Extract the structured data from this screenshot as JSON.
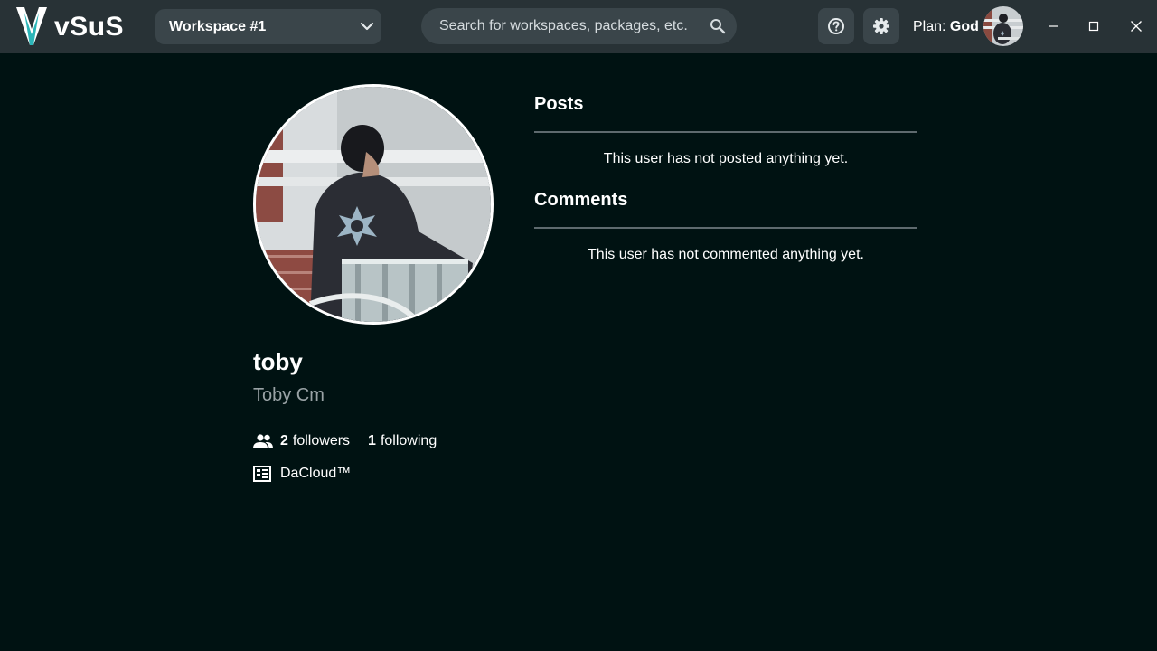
{
  "app": {
    "name": "vSuS"
  },
  "header": {
    "workspace_label": "Workspace #1",
    "search_placeholder": "Search for workspaces, packages, etc.",
    "plan_label": "Plan:",
    "plan_value": "God"
  },
  "profile": {
    "username": "toby",
    "full_name": "Toby Cm",
    "followers_count": "2",
    "followers_label": "followers",
    "following_count": "1",
    "following_label": "following",
    "organization": "DaCloud™"
  },
  "posts": {
    "title": "Posts",
    "empty_message": "This user has not posted anything yet."
  },
  "comments": {
    "title": "Comments",
    "empty_message": "This user has not commented anything yet."
  },
  "icons": {
    "help": "help-circle-icon",
    "settings": "gear-icon",
    "search": "search-icon",
    "chevron": "chevron-down-icon",
    "followers": "people-icon",
    "organization": "organization-icon"
  },
  "colors": {
    "background": "#001212",
    "titlebar": "#283236",
    "control": "#3a454a",
    "accent_teal": "#2bb5b8",
    "muted_text": "#9aa3a6"
  }
}
